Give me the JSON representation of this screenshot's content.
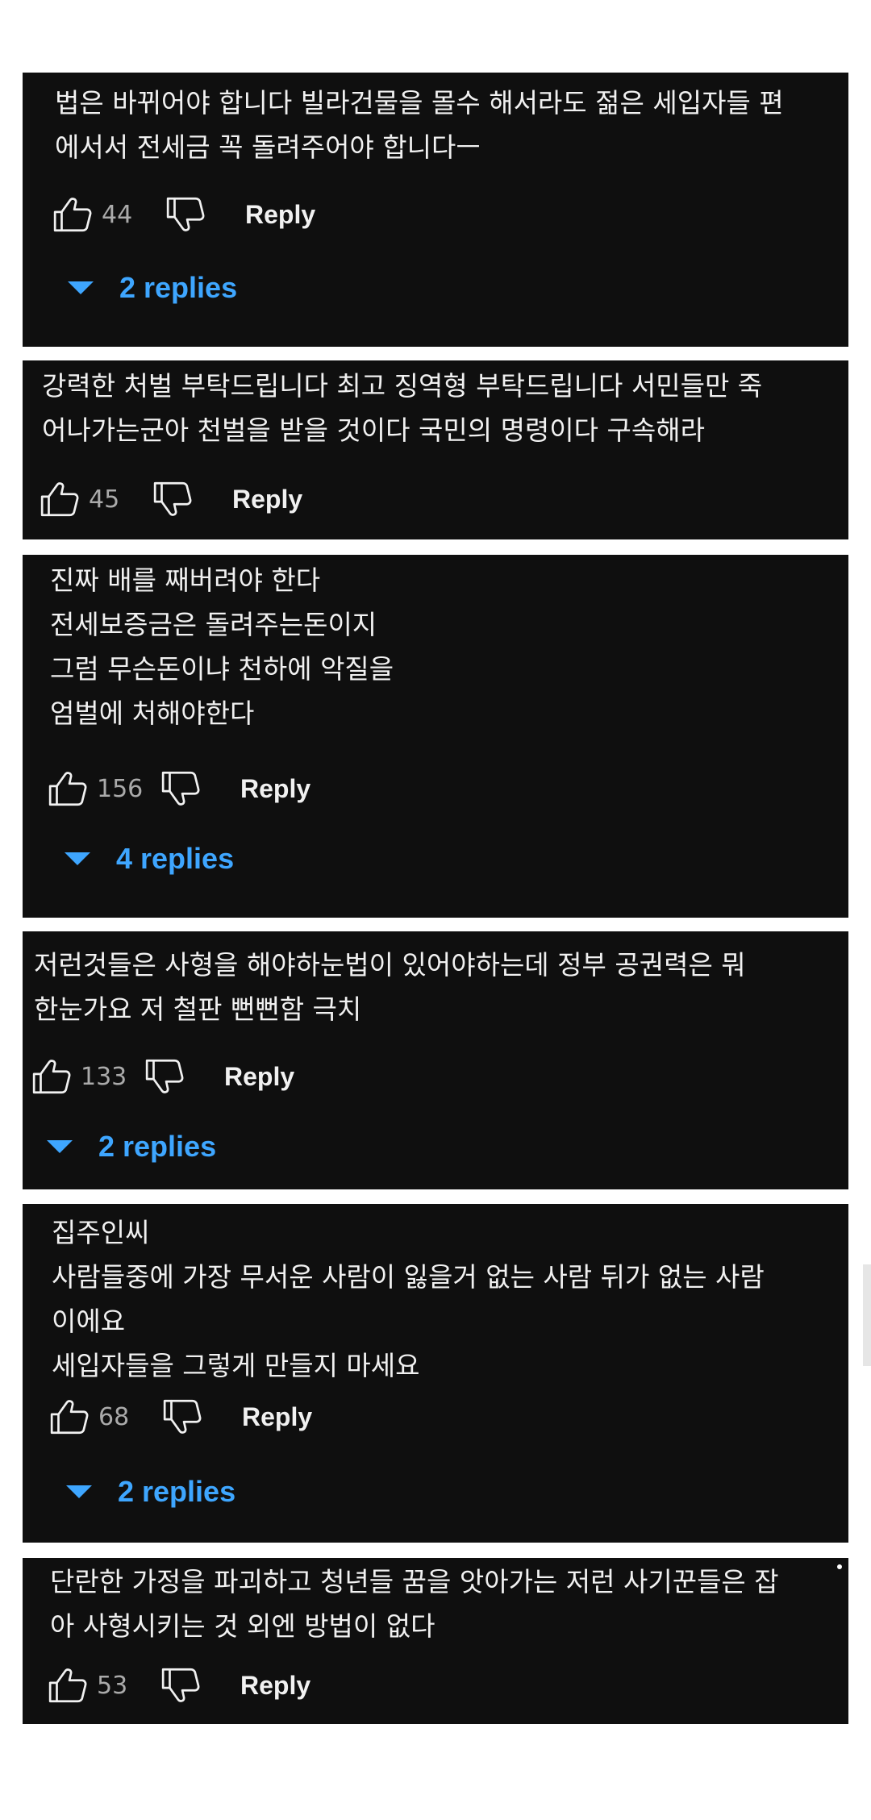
{
  "comments": [
    {
      "text": "법은 바뀌어야 합니다 빌라건물을 몰수 해서라도 젊은 세입자들 편\n에서서 전세금 꼭 돌려주어야 합니다ㅡ",
      "likes": "44",
      "reply_label": "Reply",
      "replies_label": "2 replies"
    },
    {
      "text": "강력한 처벌 부탁드립니다 최고 징역형 부탁드립니다 서민들만 죽\n어나가는군아 천벌을 받을 것이다 국민의 명령이다 구속해라",
      "likes": "45",
      "reply_label": "Reply"
    },
    {
      "text": "진짜 배를 째버려야 한다\n전세보증금은 돌려주는돈이지\n그럼 무슨돈이냐  천하에 악질을\n엄벌에 처해야한다",
      "likes": "156",
      "reply_label": "Reply",
      "replies_label": "4 replies"
    },
    {
      "text": "저런것들은 사형을 해야하눈법이 있어야하는데 정부 공권력은  뭐\n한눈가요 저 철판 뻔뻔함 극치",
      "likes": "133",
      "reply_label": "Reply",
      "replies_label": "2 replies"
    },
    {
      "text": "집주인씨\n사람들중에 가장 무서운 사람이  잃을거 없는 사람 뒤가 없는 사람\n이에요\n세입자들을 그렇게 만들지 마세요",
      "likes": "68",
      "reply_label": "Reply",
      "replies_label": "2 replies"
    },
    {
      "text": "단란한 가정을 파괴하고 청년들 꿈을 앗아가는 저런 사기꾼들은 잡\n아 사형시키는 것 외엔 방법이 없다",
      "likes": "53",
      "reply_label": "Reply"
    }
  ],
  "icons": {
    "like": "thumbs-up-icon",
    "dislike": "thumbs-down-icon",
    "expand": "triangle-down-icon"
  },
  "colors": {
    "card_bg": "#0f0f0f",
    "text": "#f1f1f1",
    "count": "#aaaaaa",
    "replies_link": "#3ea6ff"
  }
}
